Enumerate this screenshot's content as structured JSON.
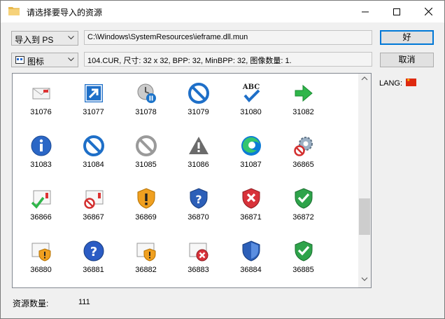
{
  "window": {
    "title": "请选择要导入的资源"
  },
  "toolbar": {
    "import_combo": "导入到 PS",
    "view_combo": "图标",
    "path": "C:\\Windows\\SystemResources\\ieframe.dll.mun",
    "info": "104.CUR, 尺寸: 32 x 32, BPP: 32, MinBPP: 32, 图像数量: 1."
  },
  "buttons": {
    "ok": "好",
    "cancel": "取消"
  },
  "lang": {
    "label": "LANG:",
    "flag_color": "#de2910"
  },
  "resources": {
    "items": [
      {
        "id": "31076",
        "icon": "envelope-icon"
      },
      {
        "id": "31077",
        "icon": "shortcut-arrow-icon"
      },
      {
        "id": "31078",
        "icon": "history-pause-icon"
      },
      {
        "id": "31079",
        "icon": "blocked-icon"
      },
      {
        "id": "31080",
        "icon": "abc-check-icon"
      },
      {
        "id": "31082",
        "icon": "green-arrow-icon"
      },
      {
        "id": "31083",
        "icon": "info-icon"
      },
      {
        "id": "31084",
        "icon": "blocked-icon"
      },
      {
        "id": "31085",
        "icon": "gray-blocked-icon"
      },
      {
        "id": "31086",
        "icon": "warning-triangle-icon"
      },
      {
        "id": "31087",
        "icon": "edge-logo-icon"
      },
      {
        "id": "36865",
        "icon": "gear-blocked-icon"
      },
      {
        "id": "36866",
        "icon": "window-check-icon"
      },
      {
        "id": "36867",
        "icon": "window-blocked-icon"
      },
      {
        "id": "36869",
        "icon": "shield-warning-icon"
      },
      {
        "id": "36870",
        "icon": "shield-question-icon"
      },
      {
        "id": "36871",
        "icon": "shield-error-icon"
      },
      {
        "id": "36872",
        "icon": "shield-check-icon"
      },
      {
        "id": "36880",
        "icon": "window-shield-warning-icon"
      },
      {
        "id": "36881",
        "icon": "help-icon"
      },
      {
        "id": "36882",
        "icon": "window-warning-icon"
      },
      {
        "id": "36883",
        "icon": "window-error-icon"
      },
      {
        "id": "36884",
        "icon": "shield-blue-icon"
      },
      {
        "id": "36885",
        "icon": "shield-green-check-icon"
      }
    ]
  },
  "status": {
    "count_label": "资源数量:",
    "count_value": "111"
  }
}
